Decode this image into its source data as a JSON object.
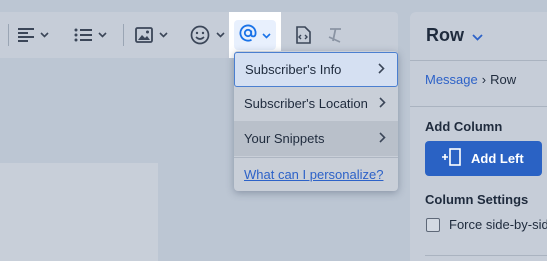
{
  "menu": {
    "items": [
      {
        "label": "Subscriber's Info",
        "chevron": "chevron-right-icon"
      },
      {
        "label": "Subscriber's Location",
        "chevron": "chevron-right-icon"
      },
      {
        "label": "Your Snippets",
        "chevron": "chevron-right-icon"
      }
    ],
    "help_link": "What can I personalize?"
  },
  "toolbar": {
    "icons": [
      "align-icon",
      "list-icon",
      "image-icon",
      "emoji-icon",
      "at-sign-icon",
      "code-icon",
      "clear-format-icon"
    ],
    "accent": "#1a73e8"
  },
  "panel": {
    "title": "Row",
    "breadcrumb": {
      "link": "Message",
      "separator": "›",
      "current": "Row"
    },
    "add_column_label": "Add Column",
    "add_left_label": "Add Left",
    "column_settings_label": "Column Settings",
    "force_side_label": "Force side-by-side"
  },
  "colors": {
    "primary_button": "#2a62c4",
    "link": "#2d62c8",
    "overlay": "#bcc6d3"
  }
}
